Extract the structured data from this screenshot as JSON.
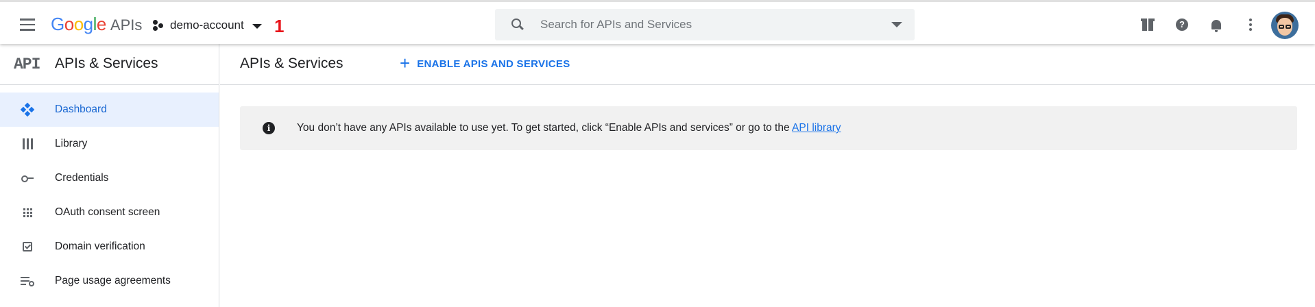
{
  "header": {
    "logo_letters": [
      "G",
      "o",
      "o",
      "g",
      "l",
      "e"
    ],
    "logo_suffix": "APIs",
    "project_name": "demo-account",
    "annotation_marker": "1",
    "search_placeholder": "Search for APIs and Services",
    "icons": [
      "menu-icon",
      "gift-icon",
      "help-icon",
      "notifications-icon",
      "more-vert-icon"
    ],
    "help_glyph": "?"
  },
  "sidebar": {
    "mark": "API",
    "title": "APIs & Services",
    "items": [
      {
        "label": "Dashboard",
        "icon": "dashboard-icon",
        "active": true
      },
      {
        "label": "Library",
        "icon": "library-icon",
        "active": false
      },
      {
        "label": "Credentials",
        "icon": "key-icon",
        "active": false
      },
      {
        "label": "OAuth consent screen",
        "icon": "oauth-icon",
        "active": false
      },
      {
        "label": "Domain verification",
        "icon": "checkbox-icon",
        "active": false
      },
      {
        "label": "Page usage agreements",
        "icon": "settings-list-icon",
        "active": false
      }
    ]
  },
  "main": {
    "title": "APIs & Services",
    "enable_button": {
      "icon": "+",
      "label": "ENABLE APIS AND SERVICES"
    },
    "banner": {
      "icon_glyph": "i",
      "message": "You don’t have any APIs available to use yet. To get started, click “Enable APIs and services” or go to the ",
      "link": "API library"
    }
  },
  "colors": {
    "accent": "#1a73e8",
    "active_bg": "#e8f0fe",
    "annotation": "#e8141a",
    "banner_bg": "#f1f1f1"
  }
}
